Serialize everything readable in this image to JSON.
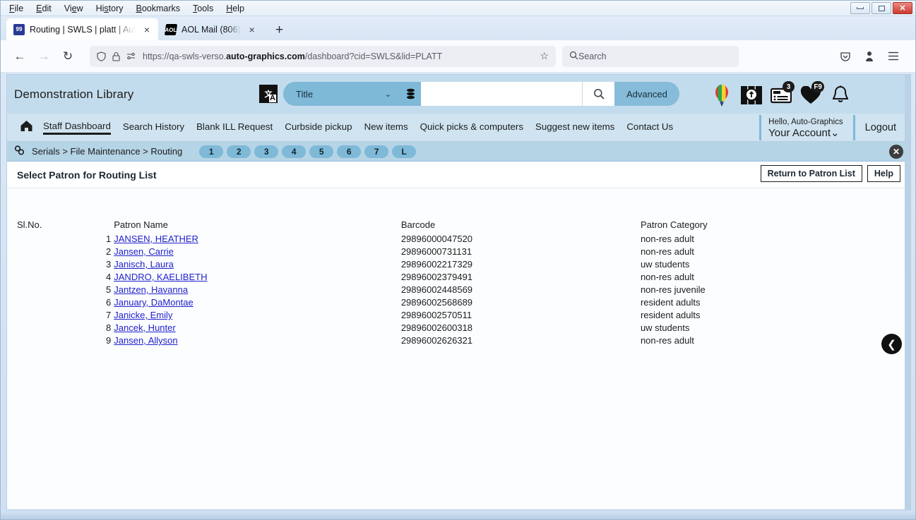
{
  "browser": {
    "menus": [
      "File",
      "Edit",
      "View",
      "History",
      "Bookmarks",
      "Tools",
      "Help"
    ],
    "window_controls": {
      "minimize": "–",
      "maximize": "❐",
      "close": "X"
    },
    "tabs": [
      {
        "title": "Routing | SWLS | platt | Auto-Gra",
        "favicon": "verso-favicon",
        "active": true,
        "close": "×"
      },
      {
        "title": "AOL Mail (806)",
        "favicon": "aol-favicon",
        "active": false,
        "close": "×"
      }
    ],
    "new_tab_label": "+",
    "nav": {
      "back": "←",
      "forward": "→",
      "reload": "↻"
    },
    "url": {
      "prefix": "https://qa-swls-verso.",
      "domain": "auto-graphics.com",
      "suffix": "/dashboard?cid=SWLS&lid=PLATT",
      "shield_icon": "shield-icon",
      "lock_icon": "lock-icon",
      "reader_icon": "reader-view-icon",
      "bookmark_icon": "star-icon"
    },
    "search": {
      "placeholder": "Search",
      "icon": "search-icon"
    },
    "toolbar_right": {
      "pocket": "save-to-pocket-icon",
      "account": "account-icon",
      "menu": "hamburger-menu-icon"
    }
  },
  "app": {
    "library_name": "Demonstration Library",
    "search": {
      "lang_icon": "translate-icon",
      "scope_selected": "Title",
      "scope_chevron": "⌄",
      "database_icon": "database-icon",
      "query_value": "",
      "query_placeholder": "",
      "go_icon": "search-icon",
      "advanced_label": "Advanced"
    },
    "header_icons": [
      {
        "name": "balloon-icon",
        "glyph": "🎈",
        "badge": ""
      },
      {
        "name": "research-icon",
        "glyph": "🔎",
        "badge": ""
      },
      {
        "name": "my-list-icon",
        "glyph": "📜",
        "badge": "3"
      },
      {
        "name": "favorites-heart-icon",
        "glyph": "♥",
        "badge": "F9"
      },
      {
        "name": "notifications-bell-icon",
        "glyph": "🔔",
        "badge": ""
      }
    ],
    "nav": {
      "home_icon": "home-icon",
      "links": [
        {
          "label": "Staff Dashboard",
          "active": true
        },
        {
          "label": "Search History",
          "active": false
        },
        {
          "label": "Blank ILL Request",
          "active": false
        },
        {
          "label": "Curbside pickup",
          "active": false
        },
        {
          "label": "New items",
          "active": false
        },
        {
          "label": "Quick picks & computers",
          "active": false
        },
        {
          "label": "Suggest new items",
          "active": false
        },
        {
          "label": "Contact Us",
          "active": false
        }
      ],
      "greeting": "Hello, Auto-Graphics",
      "account_label": "Your Account",
      "account_chevron": "⌄",
      "logout_label": "Logout"
    },
    "breadcrumb": {
      "icon": "link-chain-icon",
      "text": "Serials > File Maintenance > Routing",
      "steps": [
        "1",
        "2",
        "3",
        "4",
        "5",
        "6",
        "7",
        "L"
      ],
      "close_icon": "✕"
    },
    "page_title": "Select Patron for Routing List",
    "actions": [
      {
        "label": "Return to Patron List",
        "name": "return-to-patron-list-button"
      },
      {
        "label": "Help",
        "name": "help-button"
      }
    ],
    "table": {
      "headers": [
        "Sl.No.",
        "Patron Name",
        "Barcode",
        "Patron Category"
      ],
      "rows": [
        {
          "no": "1",
          "name": "JANSEN, HEATHER",
          "barcode": "29896000047520",
          "category": "non-res adult"
        },
        {
          "no": "2",
          "name": "Jansen, Carrie",
          "barcode": "29896000731131",
          "category": "non-res adult"
        },
        {
          "no": "3",
          "name": "Janisch, Laura",
          "barcode": "29896002217329",
          "category": "uw students"
        },
        {
          "no": "4",
          "name": "JANDRO, KAELIBETH",
          "barcode": "29896002379491",
          "category": "non-res adult"
        },
        {
          "no": "5",
          "name": "Jantzen, Havanna",
          "barcode": "29896002448569",
          "category": "non-res juvenile"
        },
        {
          "no": "6",
          "name": "January, DaMontae",
          "barcode": "29896002568689",
          "category": "resident adults"
        },
        {
          "no": "7",
          "name": "Janicke, Emily",
          "barcode": "29896002570511",
          "category": "resident adults"
        },
        {
          "no": "8",
          "name": "Jancek, Hunter",
          "barcode": "29896002600318",
          "category": "uw students"
        },
        {
          "no": "9",
          "name": "Jansen, Allyson",
          "barcode": "29896002626321",
          "category": "non-res adult"
        }
      ]
    },
    "side_arrow": {
      "name": "collapse-panel-arrow",
      "glyph": "❮"
    }
  },
  "colors": {
    "header_bg": "#c3dced",
    "nav_bg": "#cfe3f0",
    "crumb_bg": "#b5d4e6",
    "accent": "#7fb9d8",
    "link": "#2222cc"
  }
}
